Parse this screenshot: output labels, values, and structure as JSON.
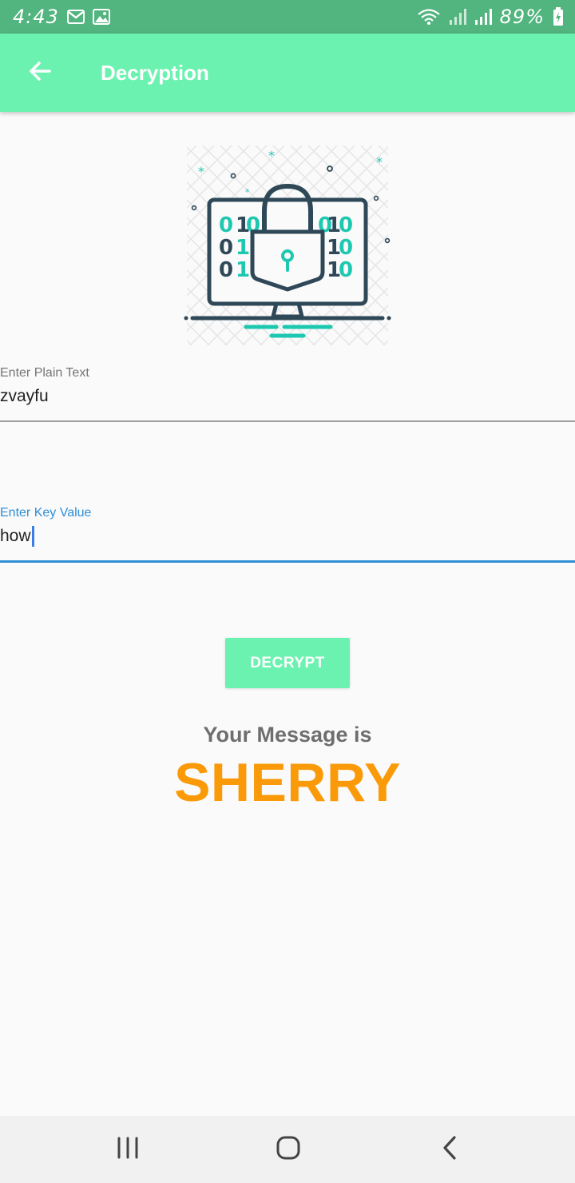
{
  "status_bar": {
    "time": "4:43",
    "battery": "89%",
    "icons": [
      "gmail-icon",
      "image-icon",
      "wifi-icon",
      "signal-icon",
      "signal-icon",
      "battery-charging-icon"
    ]
  },
  "app_bar": {
    "title": "Decryption",
    "back_icon": "arrow-left-icon",
    "color": "#6cf2b0"
  },
  "illustration": {
    "icon": "monitor-padlock-binary-icon",
    "accent": "#1ec8b0",
    "stroke": "#2f4858"
  },
  "plain_text_field": {
    "label": "Enter Plain Text",
    "value": "zvayfu"
  },
  "key_field": {
    "label": "Enter Key Value",
    "value": "how",
    "focused": true,
    "accent": "#2f8ed6"
  },
  "decrypt_button": {
    "label": "DECRYPT"
  },
  "result": {
    "caption": "Your Message is",
    "message": "SHERRY",
    "color": "#fb9a08"
  },
  "nav_bar": {
    "icons": [
      "recents-icon",
      "home-icon",
      "back-chevron-icon"
    ]
  }
}
